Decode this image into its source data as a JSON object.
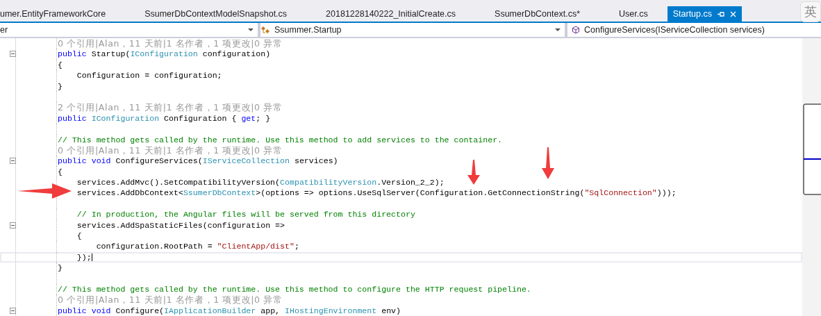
{
  "tabs": [
    {
      "label": "umer.EntityFrameworkCore",
      "selected": false
    },
    {
      "label": "SsumerDbContextModelSnapshot.cs",
      "selected": false
    },
    {
      "label": "20181228140222_InitialCreate.cs",
      "selected": false
    },
    {
      "label": "SsumerDbContext.cs*",
      "selected": false
    },
    {
      "label": "User.cs",
      "selected": false
    },
    {
      "label": "Startup.cs",
      "selected": true
    }
  ],
  "ime": "英",
  "nav": [
    {
      "kind": "project",
      "text": "er"
    },
    {
      "kind": "class",
      "text": "Ssummer.Startup"
    },
    {
      "kind": "member",
      "text": "ConfigureServices(IServiceCollection services)"
    }
  ],
  "lines": [
    {
      "kind": "lens",
      "text": "0 个引用|Alan，11 天前|1 名作者，1 项更改|0 异常"
    },
    {
      "kind": "code",
      "foldable": true,
      "current": false,
      "segments": [
        {
          "kind": "keyword",
          "text": "public"
        },
        {
          "kind": "plain",
          "text": " Startup("
        },
        {
          "kind": "type",
          "text": "IConfiguration"
        },
        {
          "kind": "plain",
          "text": " configuration)"
        }
      ]
    },
    {
      "kind": "code",
      "foldable": false,
      "current": false,
      "segments": [
        {
          "kind": "plain",
          "text": "{"
        }
      ]
    },
    {
      "kind": "code",
      "foldable": false,
      "current": false,
      "segments": [
        {
          "kind": "plain",
          "text": "    Configuration = configuration;"
        }
      ]
    },
    {
      "kind": "code",
      "foldable": false,
      "current": false,
      "segments": [
        {
          "kind": "plain",
          "text": "}"
        }
      ]
    },
    {
      "kind": "blank"
    },
    {
      "kind": "lens",
      "text": "2 个引用|Alan，11 天前|1 名作者，1 项更改|0 异常"
    },
    {
      "kind": "code",
      "foldable": false,
      "current": false,
      "segments": [
        {
          "kind": "keyword",
          "text": "public "
        },
        {
          "kind": "type",
          "text": "IConfiguration"
        },
        {
          "kind": "plain",
          "text": " Configuration { "
        },
        {
          "kind": "keyword",
          "text": "get"
        },
        {
          "kind": "plain",
          "text": "; }"
        }
      ]
    },
    {
      "kind": "blank"
    },
    {
      "kind": "code",
      "foldable": false,
      "current": false,
      "segments": [
        {
          "kind": "comment",
          "text": "// This method gets called by the runtime. Use this method to add services to the container."
        }
      ]
    },
    {
      "kind": "lens",
      "text": "0 个引用|Alan，11 天前|1 名作者，1 项更改|0 异常"
    },
    {
      "kind": "code",
      "foldable": true,
      "current": false,
      "segments": [
        {
          "kind": "keyword",
          "text": "public void"
        },
        {
          "kind": "plain",
          "text": " ConfigureServices("
        },
        {
          "kind": "type",
          "text": "IServiceCollection"
        },
        {
          "kind": "plain",
          "text": " services)"
        }
      ]
    },
    {
      "kind": "code",
      "foldable": false,
      "current": false,
      "segments": [
        {
          "kind": "plain",
          "text": "{"
        }
      ]
    },
    {
      "kind": "code",
      "foldable": false,
      "current": false,
      "segments": [
        {
          "kind": "plain",
          "text": "    services.AddMvc().SetCompatibilityVersion("
        },
        {
          "kind": "type",
          "text": "CompatibilityVersion"
        },
        {
          "kind": "plain",
          "text": ".Version_2_2);"
        }
      ]
    },
    {
      "kind": "code",
      "foldable": false,
      "current": false,
      "segments": [
        {
          "kind": "plain",
          "text": "    services.AddDbContext<"
        },
        {
          "kind": "type",
          "text": "SsumerDbContext"
        },
        {
          "kind": "plain",
          "text": ">(options => options.UseSqlServer(Configuration.GetConnectionString("
        },
        {
          "kind": "string",
          "text": "\"SqlConnection\""
        },
        {
          "kind": "plain",
          "text": ")));"
        }
      ]
    },
    {
      "kind": "blank"
    },
    {
      "kind": "code",
      "foldable": false,
      "current": false,
      "segments": [
        {
          "kind": "comment",
          "text": "    // In production, the Angular files will be served from this directory"
        }
      ]
    },
    {
      "kind": "code",
      "foldable": true,
      "current": false,
      "segments": [
        {
          "kind": "plain",
          "text": "    services.AddSpaStaticFiles(configuration =>"
        }
      ]
    },
    {
      "kind": "code",
      "foldable": false,
      "current": false,
      "segments": [
        {
          "kind": "plain",
          "text": "    {"
        }
      ]
    },
    {
      "kind": "code",
      "foldable": false,
      "current": false,
      "segments": [
        {
          "kind": "plain",
          "text": "        configuration.RootPath = "
        },
        {
          "kind": "string",
          "text": "\"ClientApp/dist\""
        },
        {
          "kind": "plain",
          "text": ";"
        }
      ]
    },
    {
      "kind": "code",
      "foldable": false,
      "current": true,
      "segments": [
        {
          "kind": "plain",
          "text": "    });"
        }
      ]
    },
    {
      "kind": "code",
      "foldable": false,
      "current": false,
      "segments": [
        {
          "kind": "plain",
          "text": "}"
        }
      ]
    },
    {
      "kind": "blank"
    },
    {
      "kind": "code",
      "foldable": false,
      "current": false,
      "segments": [
        {
          "kind": "comment",
          "text": "// This method gets called by the runtime. Use this method to configure the HTTP request pipeline."
        }
      ]
    },
    {
      "kind": "lens",
      "text": "0 个引用|Alan，11 天前|1 名作者，1 项更改|0 异常"
    },
    {
      "kind": "code",
      "foldable": true,
      "current": false,
      "segments": [
        {
          "kind": "keyword",
          "text": "public void"
        },
        {
          "kind": "plain",
          "text": " Configure("
        },
        {
          "kind": "type",
          "text": "IApplicationBuilder"
        },
        {
          "kind": "plain",
          "text": " app, "
        },
        {
          "kind": "type",
          "text": "IHostingEnvironment"
        },
        {
          "kind": "plain",
          "text": " env)"
        }
      ]
    }
  ]
}
